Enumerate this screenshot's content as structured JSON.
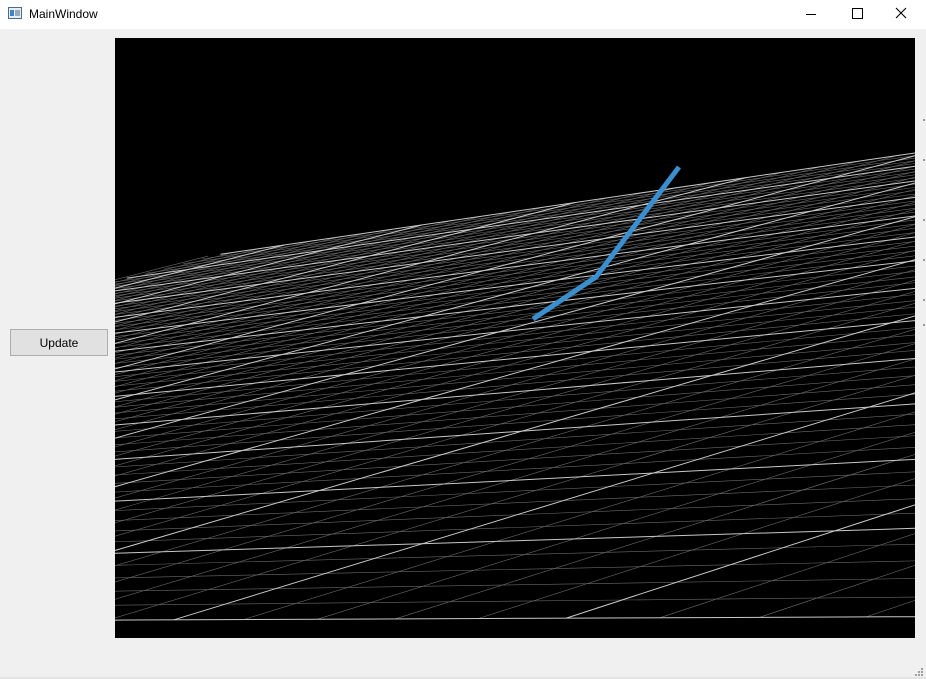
{
  "window": {
    "title": "MainWindow",
    "icon": "app-window-icon",
    "controls": [
      "minimize-icon",
      "maximize-icon",
      "close-icon"
    ]
  },
  "sidebar": {
    "update_label": "Update"
  },
  "viewport": {
    "background": "#000000",
    "grid_color": "#6a6a6a",
    "major_grid_color": "#c8c8c8",
    "line_plot": {
      "color": "#3a8fd0",
      "points_3d": "polyline of 3 vertices"
    }
  }
}
